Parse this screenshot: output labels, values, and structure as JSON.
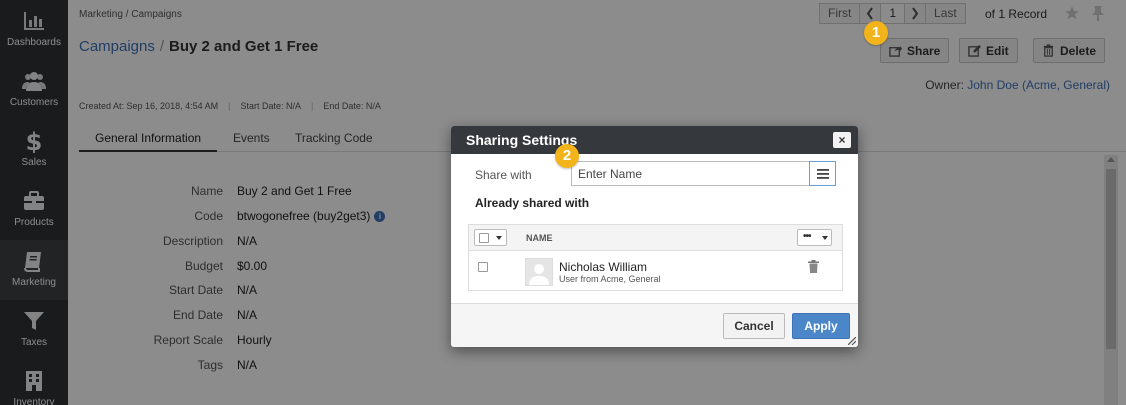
{
  "sidebar": {
    "items": [
      {
        "label": "Dashboards",
        "icon": "bar-chart-icon"
      },
      {
        "label": "Customers",
        "icon": "people-icon"
      },
      {
        "label": "Sales",
        "icon": "dollar-icon"
      },
      {
        "label": "Products",
        "icon": "briefcase-icon"
      },
      {
        "label": "Marketing",
        "icon": "book-icon"
      },
      {
        "label": "Taxes",
        "icon": "funnel-icon"
      },
      {
        "label": "Inventory",
        "icon": "building-icon"
      }
    ]
  },
  "breadcrumb": "Marketing / Campaigns",
  "pager": {
    "first": "First",
    "page": "1",
    "last": "Last",
    "record_count": "of 1 Record"
  },
  "title": {
    "parent": "Campaigns",
    "separator": "/",
    "current": "Buy 2 and Get 1 Free"
  },
  "actions": {
    "share": "Share",
    "edit": "Edit",
    "delete": "Delete"
  },
  "owner": {
    "label": "Owner:",
    "name": "John Doe",
    "org": "(Acme, General)"
  },
  "meta": {
    "created": "Created At: Sep 16, 2018, 4:54 AM",
    "start": "Start Date: N/A",
    "end": "End Date: N/A"
  },
  "tabs": [
    "General Information",
    "Events",
    "Tracking Code"
  ],
  "fields": [
    {
      "label": "Name",
      "value": "Buy 2 and Get 1 Free"
    },
    {
      "label": "Code",
      "value": "btwogonefree (buy2get3)"
    },
    {
      "label": "Description",
      "value": "N/A"
    },
    {
      "label": "Budget",
      "value": "$0.00"
    },
    {
      "label": "Start Date",
      "value": "N/A"
    },
    {
      "label": "End Date",
      "value": "N/A"
    },
    {
      "label": "Report Scale",
      "value": "Hourly"
    },
    {
      "label": "Tags",
      "value": "N/A"
    }
  ],
  "modal": {
    "title": "Sharing Settings",
    "close": "×",
    "share_with_label": "Share with",
    "share_with_placeholder": "Enter Name",
    "already_shared": "Already shared with",
    "column_name": "NAME",
    "more": "•••",
    "user": {
      "name": "Nicholas William",
      "detail": "User from Acme, General"
    },
    "cancel": "Cancel",
    "apply": "Apply"
  },
  "badges": [
    "1",
    "2"
  ],
  "colors": {
    "sidebar": "#2f3235",
    "link": "#3d72b8",
    "badge": "#f3b31b",
    "apply": "#4a86c8"
  }
}
